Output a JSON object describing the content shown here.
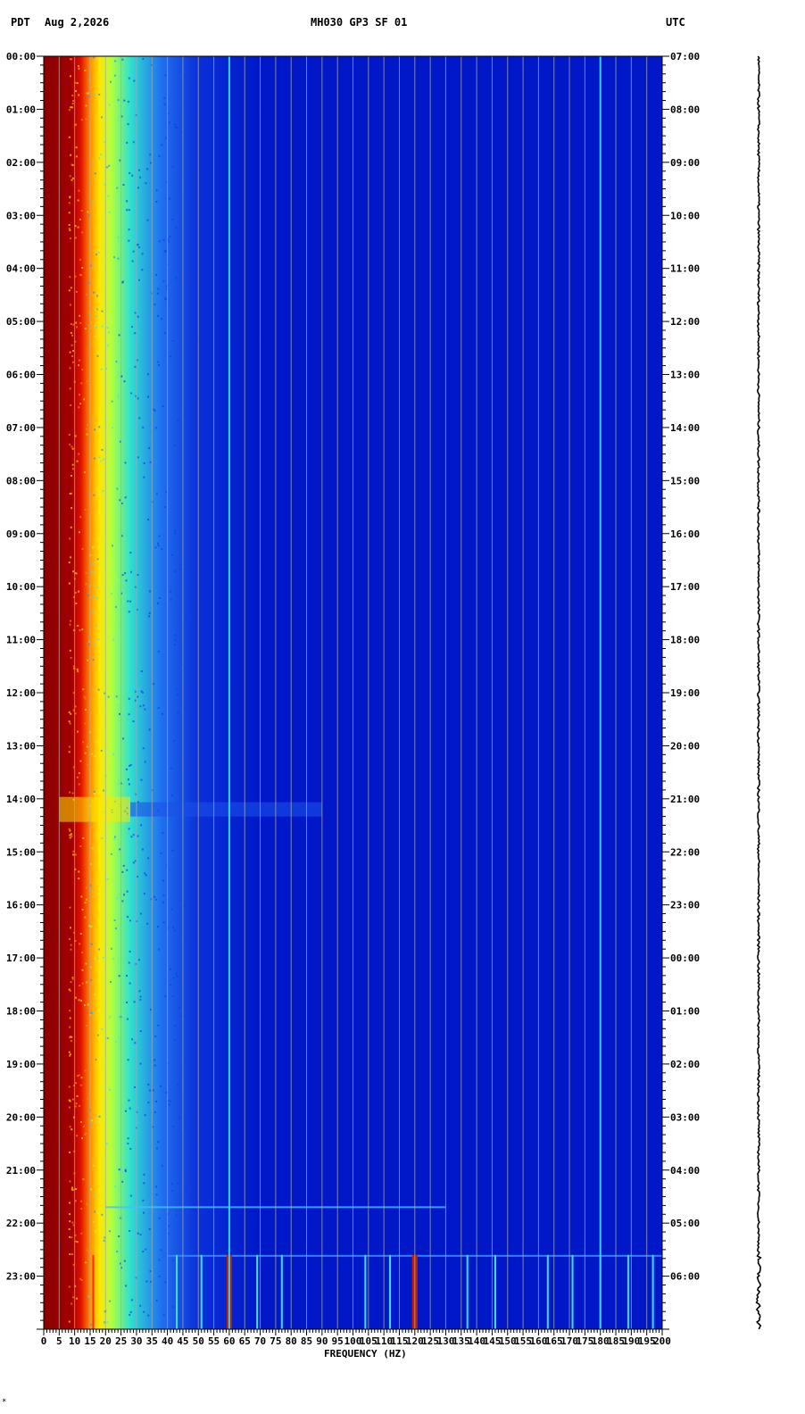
{
  "header": {
    "left_tz": "PDT",
    "date": "Aug 2,2026",
    "station": "MH030 GP3 SF 01",
    "right_tz": "UTC"
  },
  "chart_data": {
    "type": "heatmap",
    "title": "MH030 GP3 SF 01",
    "xlabel": "FREQUENCY (HZ)",
    "xlim": [
      0,
      200
    ],
    "x_ticks": [
      0,
      5,
      10,
      15,
      20,
      25,
      30,
      35,
      40,
      45,
      50,
      55,
      60,
      65,
      70,
      75,
      80,
      85,
      90,
      95,
      100,
      105,
      110,
      115,
      120,
      125,
      130,
      135,
      140,
      145,
      150,
      155,
      160,
      165,
      170,
      175,
      180,
      185,
      190,
      195,
      200
    ],
    "left_axis_label": "PDT",
    "right_axis_label": "UTC",
    "left_time_labels": [
      "00:00",
      "01:00",
      "02:00",
      "03:00",
      "04:00",
      "05:00",
      "06:00",
      "07:00",
      "08:00",
      "09:00",
      "10:00",
      "11:00",
      "12:00",
      "13:00",
      "14:00",
      "15:00",
      "16:00",
      "17:00",
      "18:00",
      "19:00",
      "20:00",
      "21:00",
      "22:00",
      "23:00"
    ],
    "right_time_labels": [
      "07:00",
      "08:00",
      "09:00",
      "10:00",
      "11:00",
      "12:00",
      "13:00",
      "14:00",
      "15:00",
      "16:00",
      "17:00",
      "18:00",
      "19:00",
      "20:00",
      "21:00",
      "22:00",
      "23:00",
      "00:00",
      "01:00",
      "02:00",
      "03:00",
      "04:00",
      "05:00",
      "06:00"
    ],
    "hours_span": 24,
    "grid": true,
    "colors": {
      "background": "#0018c8",
      "low_freq_band": "#8b0000",
      "grid_line": "#a8a8a8",
      "line_60hz": "#30d0ff",
      "line_180hz": "#30d0ff"
    },
    "persistent_lines_hz": [
      60,
      180
    ],
    "events": [
      {
        "time_hours": 14.2,
        "description_ref": "broadband increase 0-20 Hz"
      },
      {
        "time_hours": 21.7,
        "description_ref": "broadband line"
      },
      {
        "start_hours": 22.6,
        "end_hours": 24,
        "harmonic_lines_hz": [
          16,
          43,
          51,
          60,
          69,
          77,
          104,
          112,
          120,
          137,
          146,
          163,
          171,
          180,
          189,
          197
        ]
      }
    ]
  },
  "footer": {
    "mark": "*"
  }
}
